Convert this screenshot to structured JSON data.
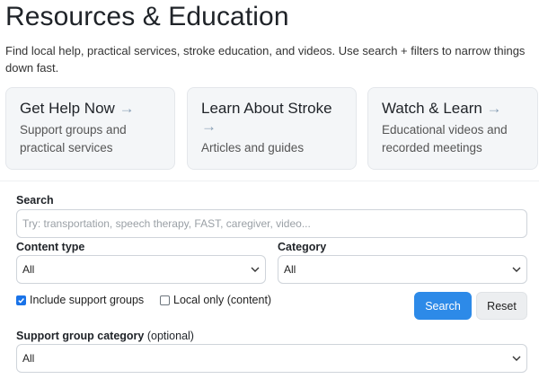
{
  "page": {
    "title": "Resources & Education",
    "intro": "Find local help, practical services, stroke education, and videos. Use search + filters to narrow things down fast."
  },
  "cards": [
    {
      "title": "Get Help Now",
      "arrow": "→",
      "subtitle": "Support groups and practical services"
    },
    {
      "title": "Learn About Stroke",
      "arrow": "→",
      "subtitle": "Articles and guides"
    },
    {
      "title": "Watch & Learn",
      "arrow": "→",
      "subtitle": "Educational videos and recorded meetings"
    }
  ],
  "filters": {
    "search_label": "Search",
    "search_placeholder": "Try: transportation, speech therapy, FAST, caregiver, video...",
    "search_value": "",
    "content_type_label": "Content type",
    "content_type_value": "All",
    "category_label": "Category",
    "category_value": "All",
    "include_support_groups_label": "Include support groups",
    "include_support_groups_checked": true,
    "local_only_label": "Local only (content)",
    "local_only_checked": false,
    "search_button": "Search",
    "reset_button": "Reset",
    "support_group_category_label": "Support group category",
    "support_group_category_optional": "(optional)",
    "support_group_category_value": "All"
  },
  "colors": {
    "primary": "#2d8ae8",
    "card_bg": "#f4f6f8",
    "checkbox_checked": "#1a73e8"
  }
}
